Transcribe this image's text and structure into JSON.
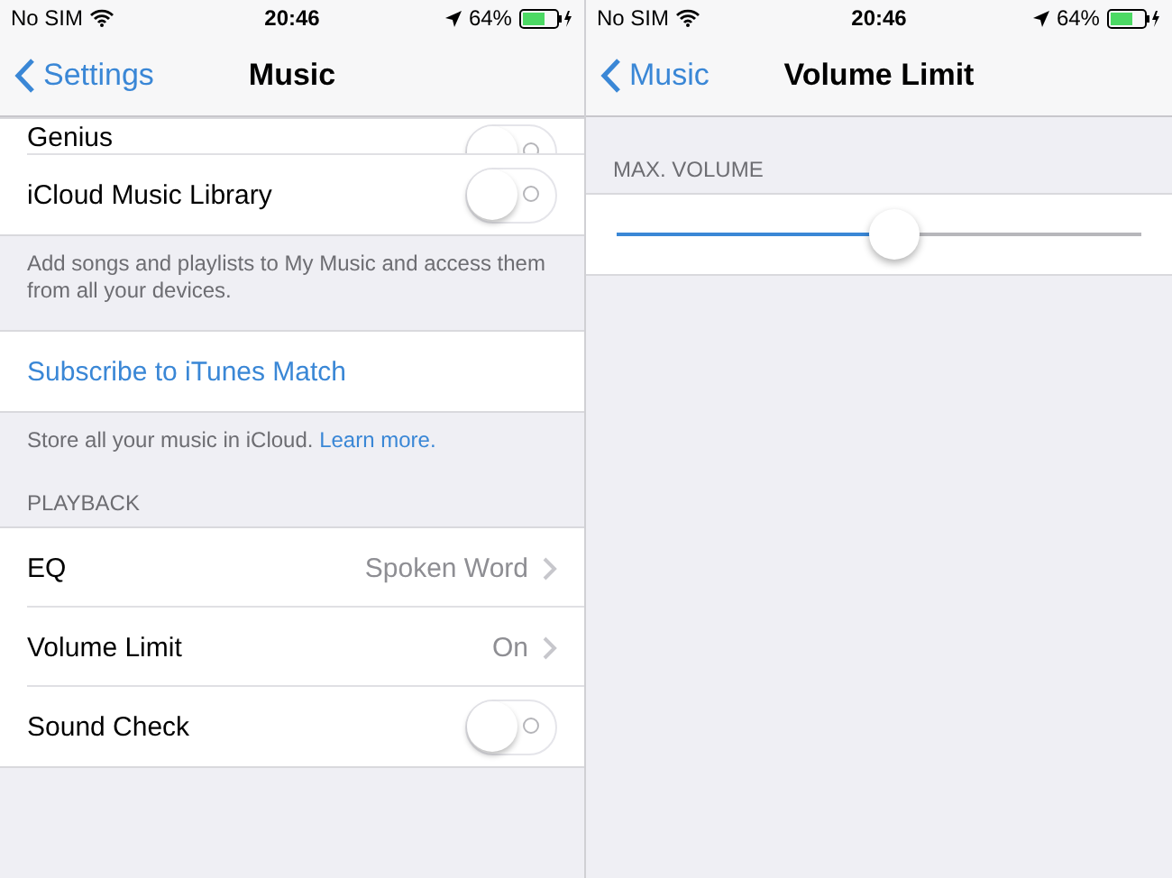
{
  "screens": [
    {
      "status_bar": {
        "carrier": "No SIM",
        "time": "20:46",
        "battery": "64%"
      },
      "nav": {
        "back": "Settings",
        "title": "Music"
      },
      "sections": [
        {
          "rows": [
            {
              "kind": "toggle",
              "label": "Genius",
              "on": false,
              "partial": true
            },
            {
              "kind": "toggle",
              "label": "iCloud Music Library",
              "on": false,
              "partial": false
            }
          ],
          "footer": {
            "text": "Add songs and playlists to My Music and access them from all your devices."
          }
        },
        {
          "rows": [
            {
              "kind": "action",
              "label": "Subscribe to iTunes Match"
            }
          ],
          "footer": {
            "text": "Store all your music in iCloud.",
            "link": "Learn more."
          }
        },
        {
          "header": "PLAYBACK",
          "rows": [
            {
              "kind": "detail",
              "label": "EQ",
              "value": "Spoken Word"
            },
            {
              "kind": "detail",
              "label": "Volume Limit",
              "value": "On"
            },
            {
              "kind": "toggle",
              "label": "Sound Check",
              "on": false,
              "partial": false
            }
          ]
        }
      ]
    },
    {
      "status_bar": {
        "carrier": "No SIM",
        "time": "20:46",
        "battery": "64%"
      },
      "nav": {
        "back": "Music",
        "title": "Volume Limit"
      },
      "sections": [
        {
          "header": "MAX. VOLUME",
          "rows": [
            {
              "kind": "slider",
              "level": 0.53
            }
          ]
        }
      ]
    }
  ]
}
